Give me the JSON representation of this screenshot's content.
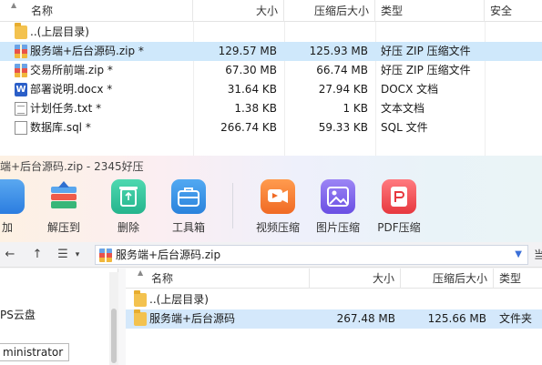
{
  "top_list": {
    "columns": {
      "name": "名称",
      "size": "大小",
      "compressed": "压缩后大小",
      "type": "类型",
      "security": "安全"
    },
    "rows": [
      {
        "name": "..(上层目录)",
        "size": "",
        "compressed": "",
        "type": "",
        "icon": "folder-up-icon"
      },
      {
        "name": "服务端+后台源码.zip *",
        "size": "129.57 MB",
        "compressed": "125.93 MB",
        "type": "好压 ZIP 压缩文件",
        "icon": "zip-archive-icon"
      },
      {
        "name": "交易所前端.zip *",
        "size": "67.30 MB",
        "compressed": "66.74 MB",
        "type": "好压 ZIP 压缩文件",
        "icon": "zip-archive-icon"
      },
      {
        "name": "部署说明.docx *",
        "size": "31.64 KB",
        "compressed": "27.94 KB",
        "type": "DOCX 文档",
        "icon": "word-doc-icon"
      },
      {
        "name": "计划任务.txt *",
        "size": "1.38 KB",
        "compressed": "1 KB",
        "type": "文本文档",
        "icon": "text-file-icon"
      },
      {
        "name": "数据库.sql *",
        "size": "266.74 KB",
        "compressed": "59.33 KB",
        "type": "SQL 文件",
        "icon": "sql-file-icon"
      }
    ]
  },
  "toolbar_window": {
    "title": "端+后台源码.zip - 2345好压",
    "tools": [
      {
        "label": "加",
        "icon": "add-icon",
        "color": "#2b7de0"
      },
      {
        "label": "解压到",
        "icon": "extract-icon",
        "color": "#2e8be6"
      },
      {
        "label": "删除",
        "icon": "recycle-bin-icon",
        "color": "#2fc19a"
      },
      {
        "label": "工具箱",
        "icon": "toolbox-icon",
        "color": "#2f8ee3"
      },
      {
        "label": "视频压缩",
        "icon": "video-compress-icon",
        "color": "#f0722d"
      },
      {
        "label": "图片压缩",
        "icon": "image-compress-icon",
        "color": "#7b5ee8"
      },
      {
        "label": "PDF压缩",
        "icon": "pdf-compress-icon",
        "color": "#ee4b52"
      }
    ]
  },
  "bottom": {
    "path": "服务端+后台源码.zip",
    "right_cut": "当",
    "left_pane": {
      "text1": "PS云盘",
      "user": "ministrator"
    },
    "columns": {
      "name": "名称",
      "size": "大小",
      "compressed": "压缩后大小",
      "type": "类型"
    },
    "rows": [
      {
        "name": "..(上层目录)",
        "size": "",
        "compressed": "",
        "type": "",
        "icon": "folder-up-icon"
      },
      {
        "name": "服务端+后台源码",
        "size": "267.48 MB",
        "compressed": "125.66 MB",
        "type": "文件夹",
        "icon": "folder-icon"
      }
    ]
  }
}
